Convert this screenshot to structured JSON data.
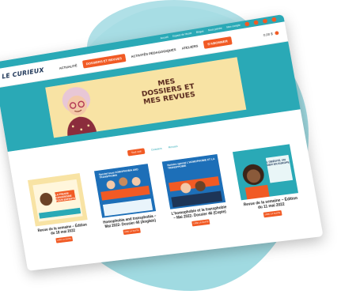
{
  "topbar": {
    "links": [
      "Accueil",
      "Espace de l'école",
      "Blogue",
      "Nous joindre",
      "Mon compte"
    ],
    "socials": [
      "facebook-icon",
      "instagram-icon",
      "youtube-icon",
      "linkedin-icon"
    ]
  },
  "nav": {
    "logo": "LE CURIEUX",
    "items": [
      "ACTUALITÉ",
      "DOSSIERS ET REVUES",
      "ACTIVITÉS PÉDAGOGIQUES",
      "ATELIERS",
      "S'ABONNER"
    ],
    "cart_label": "0,00 $",
    "active_color": "#f15a24"
  },
  "hero": {
    "title_line1": "MES",
    "title_line2": "DOSSIERS ET",
    "title_line3": "MES REVUES",
    "bg_color": "#2aa9b6",
    "panel_color": "#f8e3a4"
  },
  "filters": [
    "Tout voir",
    "Dossiers",
    "Revues"
  ],
  "cards": [
    {
      "title": "Revue de la semaine – Édition du 18 mai 2022",
      "button": "LIRE LA SUITE",
      "thumb_text": "LA PRESSE CANADIENNE POUR ENFANTS"
    },
    {
      "title": "Homophobia and transphobia – Mai 2022- Dossier 46 (Anglais)",
      "button": "LIRE LA SUITE",
      "thumb_text": "Special issue HOMOPHOBIA AND TRANSPHOBIA"
    },
    {
      "title": "L'homophobie et la transphobie – Mai 2022- Dossier 46 (Copie)",
      "button": "LIRE LA SUITE",
      "thumb_text": "Numéro spécial L'HOMOPHOBIE ET LA TRANSPHOBIE"
    },
    {
      "title": "Revue de la semaine – Édition du 11 mai 2022",
      "button": "LIRE LA SUITE",
      "thumb_text": "L'OBÉSITÉ, UN DÉFI EN EUROPE"
    }
  ]
}
